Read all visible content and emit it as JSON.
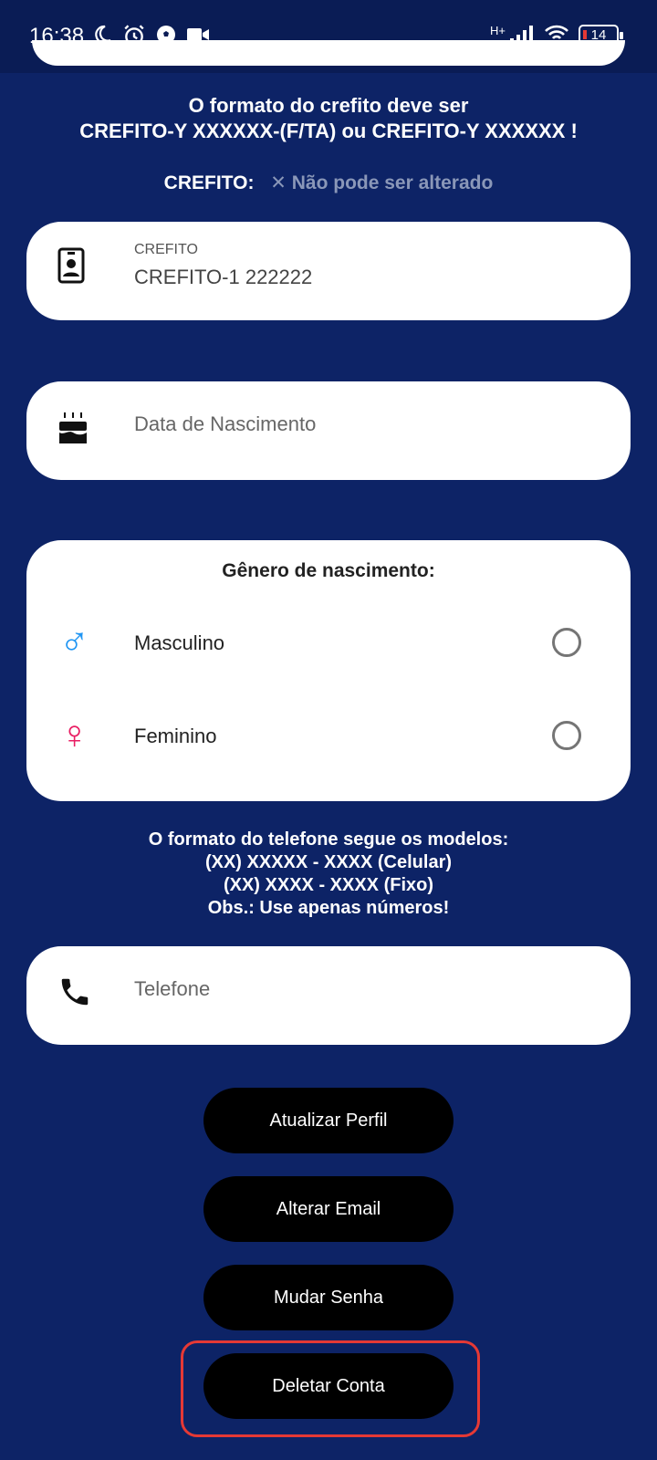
{
  "status_bar": {
    "time": "16:38",
    "network": "H+",
    "battery": "14",
    "icons": [
      "moon-icon",
      "alarm-icon",
      "soccer-ball-icon",
      "video-camera-icon",
      "signal-icon",
      "wifi-icon",
      "battery-icon"
    ]
  },
  "crefito_note": {
    "line1": "O formato do crefito deve ser",
    "line2": "CREFITO-Y XXXXXX-(F/TA) ou CREFITO-Y XXXXXX !"
  },
  "crefito_status": {
    "label": "CREFITO:",
    "value": "Não pode ser alterado"
  },
  "crefito_field": {
    "label": "CREFITO",
    "value": "CREFITO-1 222222"
  },
  "birthdate_field": {
    "placeholder": "Data de Nascimento"
  },
  "gender": {
    "title": "Gênero de nascimento:",
    "options": [
      {
        "label": "Masculino",
        "symbol": "♂",
        "color": "#2196f3"
      },
      {
        "label": "Feminino",
        "symbol": "♀",
        "color": "#e91e63"
      }
    ]
  },
  "phone_note": {
    "line1": "O formato do telefone segue os modelos:",
    "line2": "(XX) XXXXX - XXXX (Celular)",
    "line3": "(XX) XXXX - XXXX (Fixo)",
    "line4": "Obs.: Use apenas números!"
  },
  "phone_field": {
    "placeholder": "Telefone"
  },
  "buttons": {
    "update_profile": "Atualizar Perfil",
    "change_email": "Alterar Email",
    "change_password": "Mudar Senha",
    "delete_account": "Deletar Conta"
  },
  "colors": {
    "background": "#0d2366",
    "button": "#000000",
    "highlight": "#e53935"
  }
}
